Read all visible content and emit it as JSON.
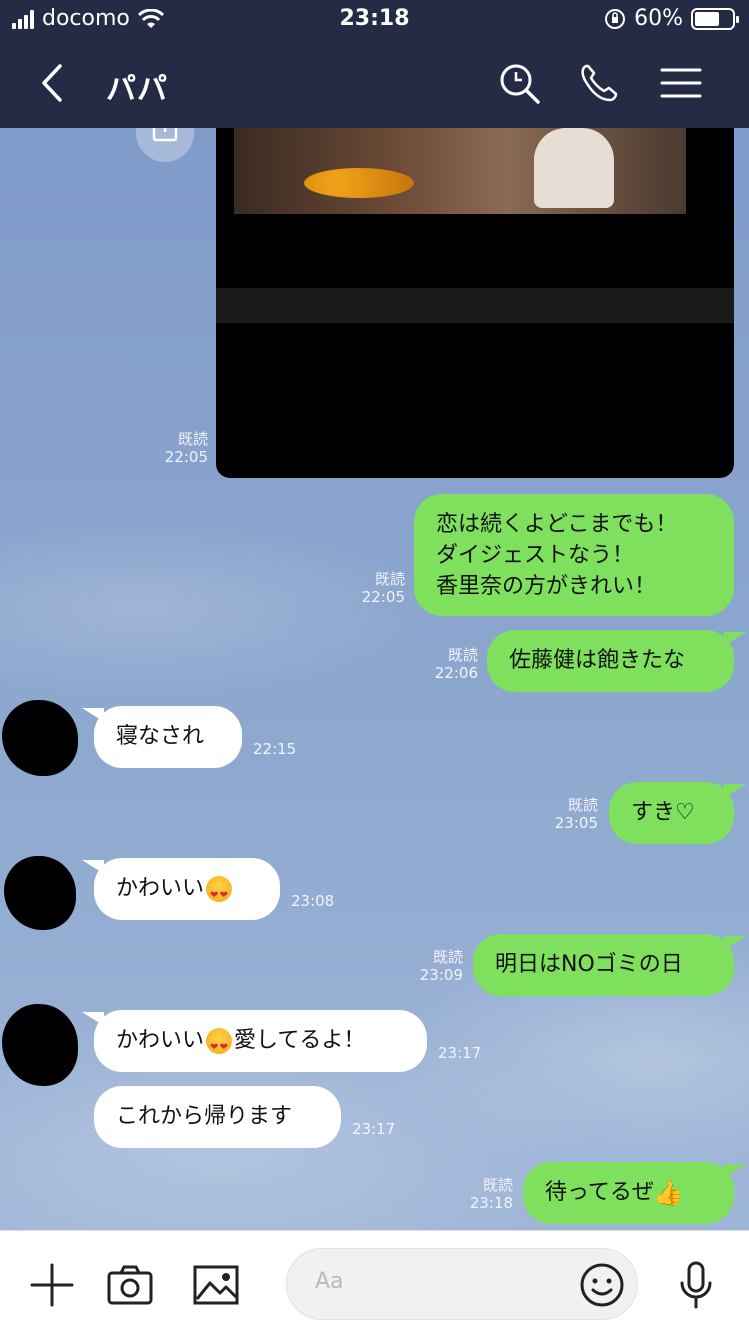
{
  "status_bar": {
    "carrier": "docomo",
    "time": "23:18",
    "battery": "60%"
  },
  "header": {
    "title": "パパ"
  },
  "messages": [
    {
      "side": "right",
      "read": "既読",
      "time": "22:05",
      "text": "恋は続くよどこまでも！\nダイジェストなう！\n香里奈の方がきれい！"
    },
    {
      "side": "right",
      "read": "既読",
      "time": "22:06",
      "text": "佐藤健は飽きたな"
    },
    {
      "side": "left",
      "time": "22:15",
      "text": "寝なされ"
    },
    {
      "side": "right",
      "read": "既読",
      "time": "23:05",
      "text": "すき♡"
    },
    {
      "side": "left",
      "time": "23:08",
      "text": "かわいい"
    },
    {
      "side": "right",
      "read": "既読",
      "time": "23:09",
      "text": "明日はNOゴミの日"
    },
    {
      "side": "left",
      "time": "23:17",
      "text_before": "かわいい",
      "text_after": "愛してるよ！"
    },
    {
      "side": "left",
      "time": "23:17",
      "text": "これから帰ります"
    },
    {
      "side": "right",
      "read": "既読",
      "time": "23:18",
      "text": "待ってるぜ"
    }
  ],
  "media": {
    "read": "既読",
    "time": "22:05"
  },
  "input": {
    "placeholder": "Aa"
  }
}
